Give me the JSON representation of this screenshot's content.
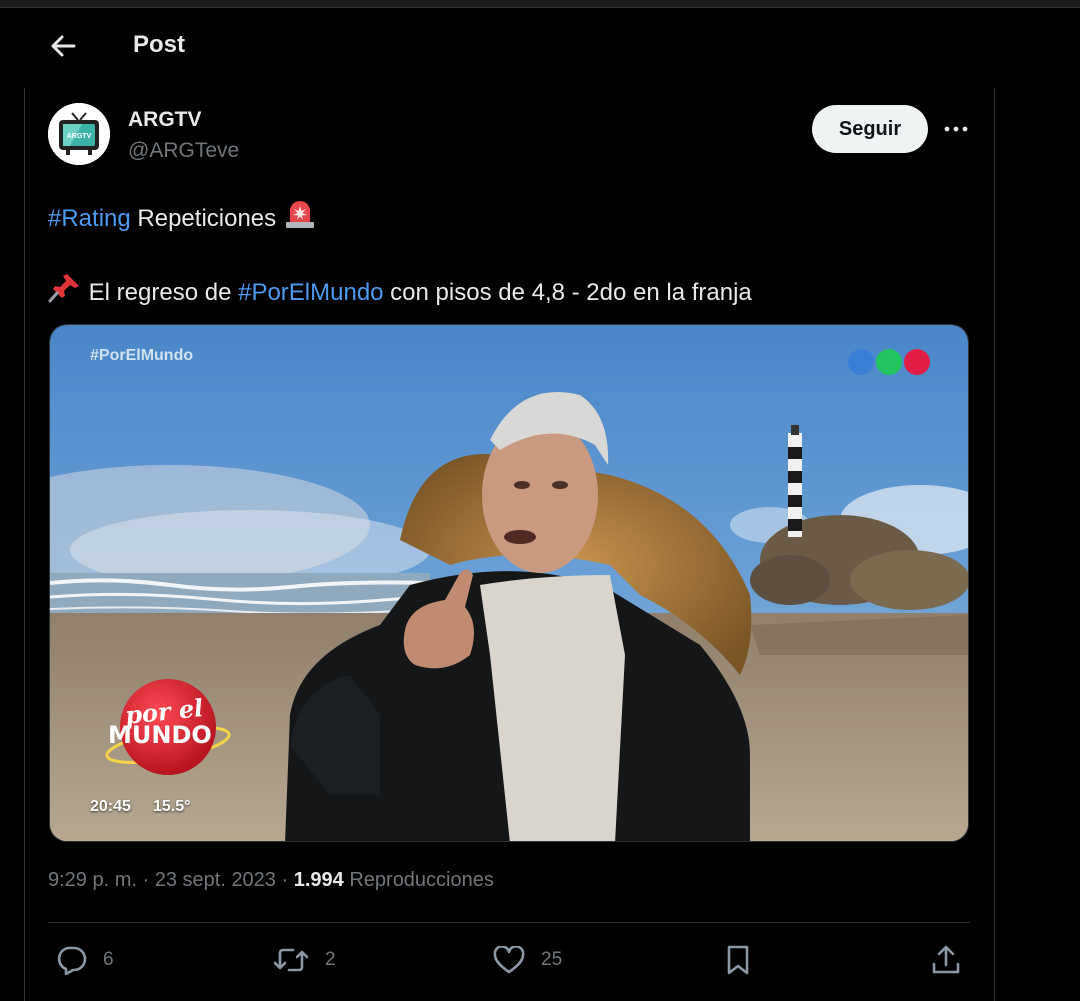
{
  "header": {
    "title": "Post"
  },
  "author": {
    "display_name": "ARGTV",
    "handle": "@ARGTeve",
    "avatar_label": "ARGTV"
  },
  "follow_label": "Seguir",
  "tweet": {
    "line1": {
      "hashtag": "#Rating",
      "text": " Repeticiones "
    },
    "line2": {
      "prefix": " El regreso de ",
      "hashtag": "#PorElMundo",
      "suffix": " con pisos de 4,8 - 2do en la franja"
    }
  },
  "media": {
    "tag": "#PorElMundo",
    "logo_line1": "por el",
    "logo_line2": "MUNDO",
    "time": "20:45",
    "temp": "15.5°"
  },
  "meta": {
    "time": "9:29 p. m.",
    "sep1": " · ",
    "date": "23 sept. 2023",
    "sep2": " · ",
    "views": "1.994",
    "views_label": " Reproducciones"
  },
  "actions": {
    "replies": "6",
    "reposts": "2",
    "likes": "25"
  },
  "colors": {
    "accent": "#4d9bef",
    "background": "#000000",
    "muted": "#71767b"
  },
  "icons": [
    "back-arrow-icon",
    "more-icon",
    "alarm-light-icon",
    "pushpin-icon",
    "reply-icon",
    "repost-icon",
    "like-icon",
    "bookmark-icon",
    "share-icon"
  ]
}
